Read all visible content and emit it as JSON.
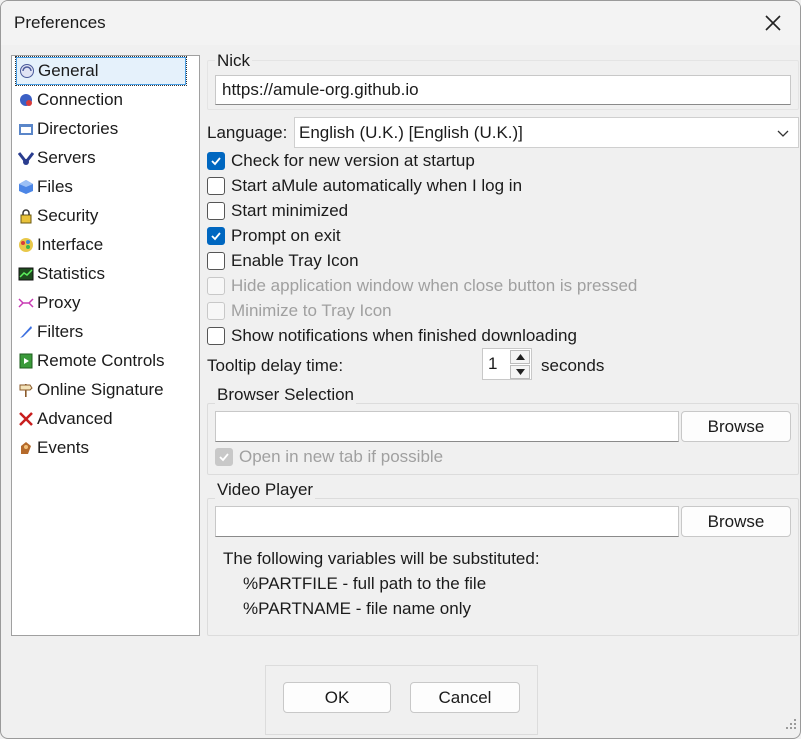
{
  "window": {
    "title": "Preferences"
  },
  "sidebar": {
    "items": [
      {
        "label": "General",
        "icon": "general-icon"
      },
      {
        "label": "Connection",
        "icon": "connection-icon"
      },
      {
        "label": "Directories",
        "icon": "directories-icon"
      },
      {
        "label": "Servers",
        "icon": "servers-icon"
      },
      {
        "label": "Files",
        "icon": "files-icon"
      },
      {
        "label": "Security",
        "icon": "lock-icon"
      },
      {
        "label": "Interface",
        "icon": "interface-icon"
      },
      {
        "label": "Statistics",
        "icon": "statistics-icon"
      },
      {
        "label": "Proxy",
        "icon": "proxy-icon"
      },
      {
        "label": "Filters",
        "icon": "filters-icon"
      },
      {
        "label": "Remote Controls",
        "icon": "remote-controls-icon"
      },
      {
        "label": "Online Signature",
        "icon": "signpost-icon"
      },
      {
        "label": "Advanced",
        "icon": "advanced-icon"
      },
      {
        "label": "Events",
        "icon": "events-icon"
      }
    ],
    "selected": "General"
  },
  "general": {
    "nick_label": "Nick",
    "nick_value": "https://amule-org.github.io",
    "language_label": "Language:",
    "language_value": "English (U.K.) [English (U.K.)]",
    "checkboxes": [
      {
        "label": "Check for new version at startup",
        "checked": true,
        "enabled": true
      },
      {
        "label": "Start aMule automatically when I log in",
        "checked": false,
        "enabled": true
      },
      {
        "label": "Start minimized",
        "checked": false,
        "enabled": true
      },
      {
        "label": "Prompt on exit",
        "checked": true,
        "enabled": true
      },
      {
        "label": "Enable Tray Icon",
        "checked": false,
        "enabled": true
      },
      {
        "label": "Hide application window when close button is pressed",
        "checked": false,
        "enabled": false
      },
      {
        "label": "Minimize to Tray Icon",
        "checked": false,
        "enabled": false
      },
      {
        "label": "Show notifications when finished downloading",
        "checked": false,
        "enabled": true
      }
    ],
    "tooltip_label": "Tooltip delay time:",
    "tooltip_value": "1",
    "tooltip_unit": "seconds",
    "browser": {
      "title": "Browser Selection",
      "path_value": "",
      "browse_label": "Browse",
      "new_tab_label": "Open in new tab if possible",
      "new_tab_checked": true,
      "new_tab_enabled": false
    },
    "video": {
      "title": "Video Player",
      "path_value": "",
      "browse_label": "Browse",
      "info_line1": "The following variables will be substituted:",
      "info_line2": "%PARTFILE - full path to the file",
      "info_line3": "%PARTNAME - file name only"
    }
  },
  "footer": {
    "ok_label": "OK",
    "cancel_label": "Cancel"
  },
  "colors": {
    "accent": "#0067c0",
    "background": "#f0f0f0"
  }
}
